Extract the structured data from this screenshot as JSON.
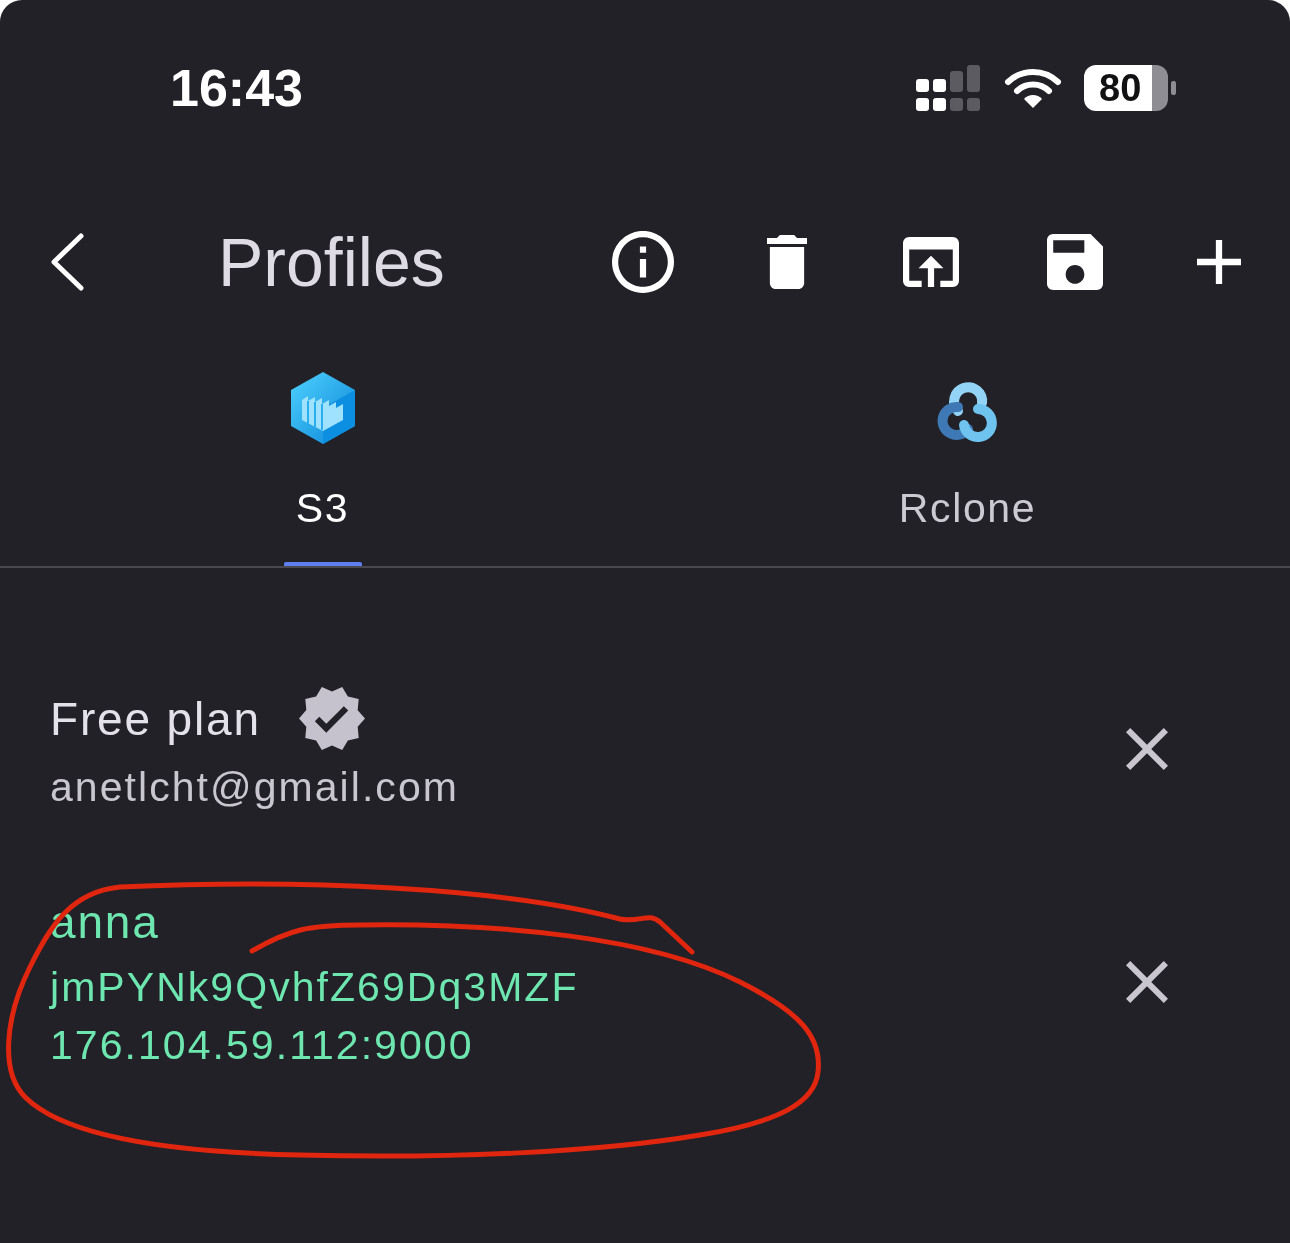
{
  "status_bar": {
    "time": "16:43",
    "battery": "80"
  },
  "header": {
    "title": "Profiles"
  },
  "tabs": [
    {
      "kind": "s3",
      "label": "S3",
      "selected": true
    },
    {
      "kind": "rclone",
      "label": "Rclone",
      "selected": false
    }
  ],
  "profiles": [
    {
      "title": "Free plan",
      "verified": true,
      "lines": [
        "anetlcht@gmail.com"
      ],
      "selected": false,
      "circled": false
    },
    {
      "title": "anna",
      "verified": false,
      "lines": [
        "jmPYNk9QvhfZ69Dq3MZF",
        "176.104.59.112:9000"
      ],
      "selected": true,
      "circled": true
    }
  ]
}
